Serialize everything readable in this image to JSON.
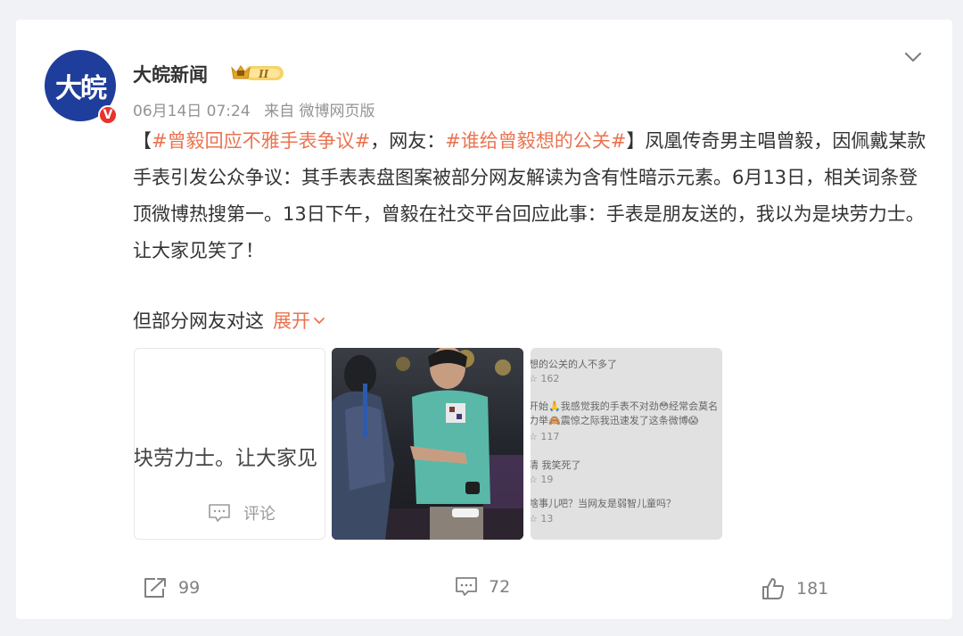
{
  "post": {
    "avatar_text": "大皖",
    "username": "大皖新闻",
    "level_badge": "II",
    "time": "06月14日 07:24",
    "source": "来自 微博网页版",
    "content": {
      "bracket_open": "【",
      "tag1": "#曾毅回应不雅手表争议#",
      "mid1": "，网友：",
      "tag2": "#谁给曾毅想的公关#",
      "rest": "】凤凰传奇男主唱曾毅，因佩戴某款手表引发公众争议：其手表表盘图案被部分网友解读为含有性暗示元素。6月13日，相关词条登顶微博热搜第一。13日下午，曾毅在社交平台回应此事：手表是朋友送的，我以为是块劳力士。让大家见笑了！"
    },
    "more_text": "但部分网友对这",
    "expand_label": "展开"
  },
  "images": {
    "image1": {
      "text": "块劳力士。让大家见",
      "comment_label": "评论"
    },
    "image3": {
      "lines": [
        {
          "text": "想的公关的人不多了",
          "count": "162"
        },
        {
          "text": "开始🙏我感觉我的手表不对劲😳经常会莫名",
          "text2": "力举🙈震惊之际我迅速发了这条微博😱",
          "count": "117"
        },
        {
          "text": "清 我笑死了",
          "count": "19"
        },
        {
          "text": "啥事儿吧？当网友是弱智儿童吗？",
          "count": "13"
        }
      ]
    }
  },
  "actions": {
    "repost_count": "99",
    "comment_count": "72",
    "like_count": "181"
  },
  "colors": {
    "accent": "#eb7350",
    "avatar_bg": "#1f3e9b",
    "verified": "#e8322d",
    "background": "#f1f2f5"
  },
  "icons": [
    "chevron-down-icon",
    "repost-icon",
    "comment-icon",
    "like-icon",
    "verified-icon",
    "level-badge-icon"
  ]
}
